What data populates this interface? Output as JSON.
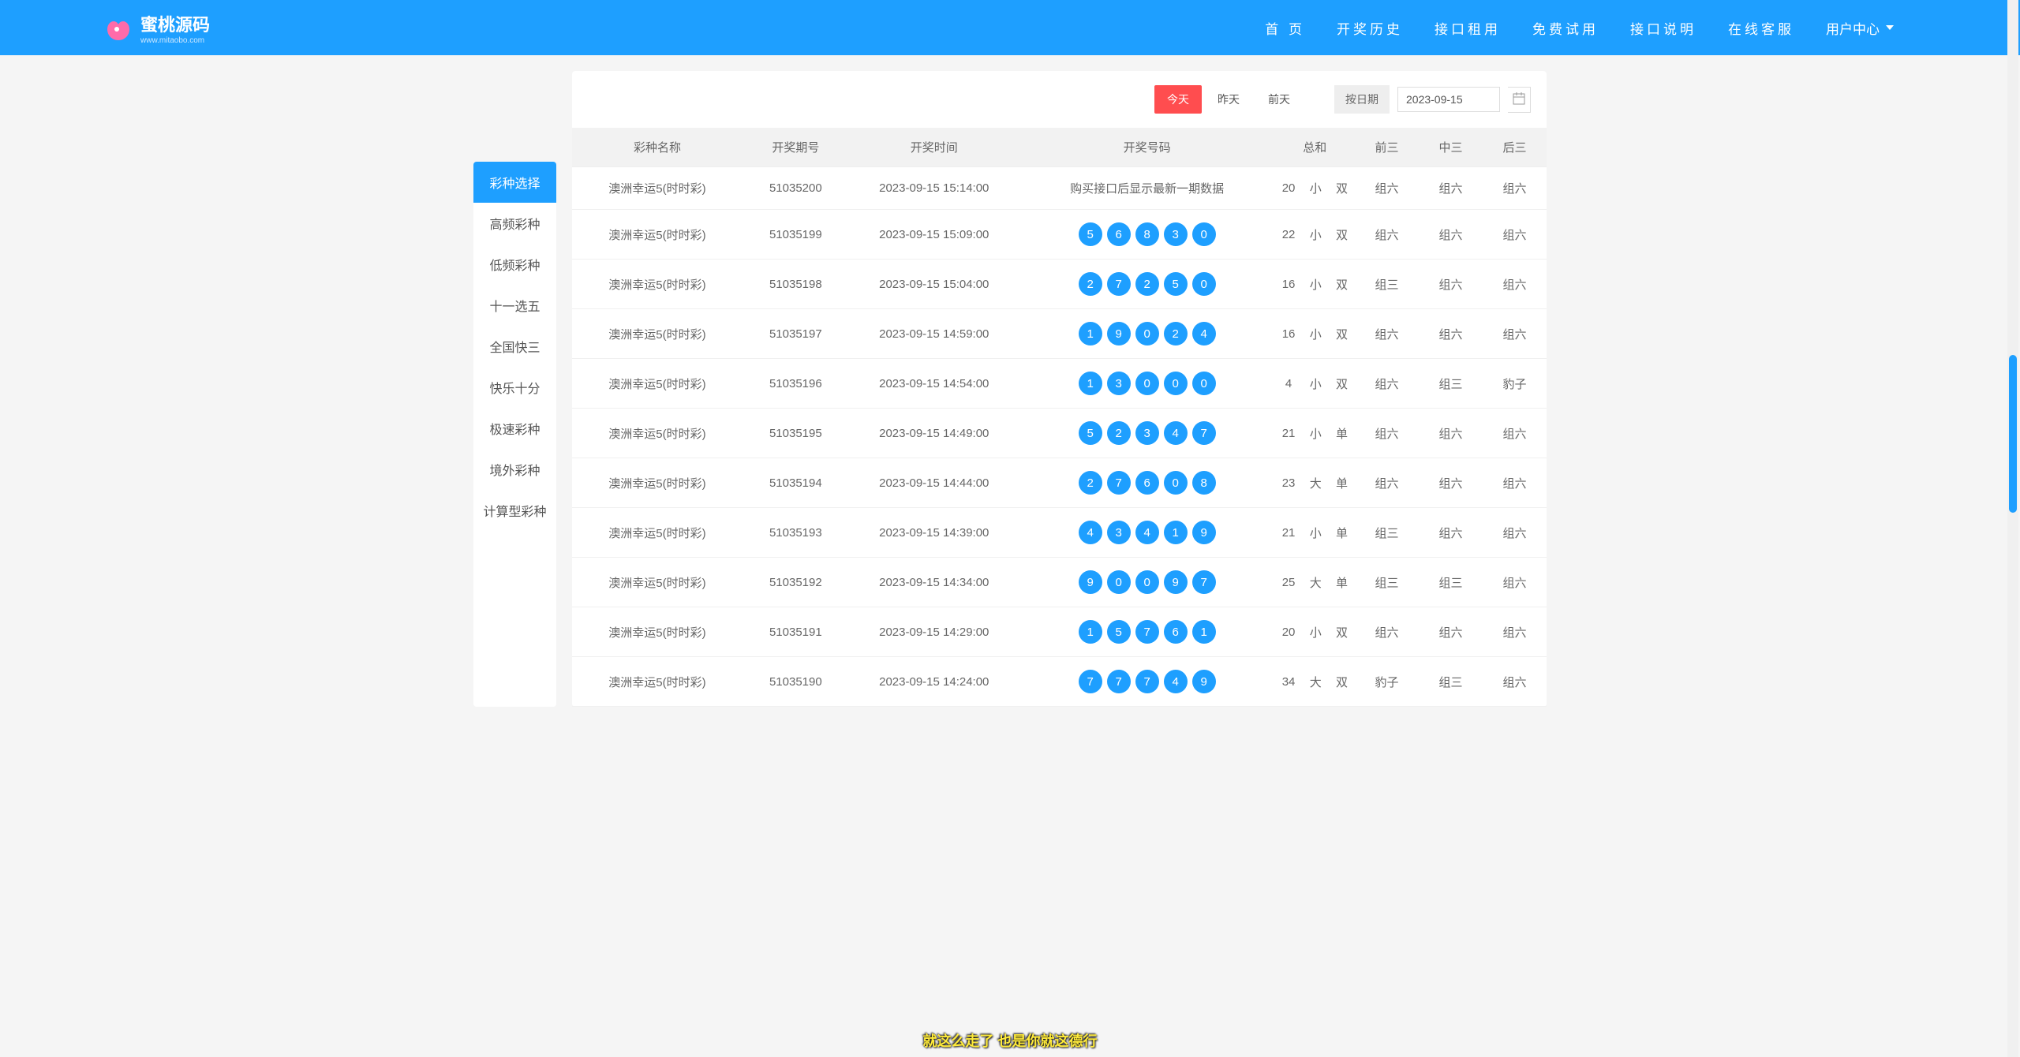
{
  "header": {
    "logo_title": "蜜桃源码",
    "logo_sub": "www.mitaobo.com",
    "nav": [
      "首 页",
      "开奖历史",
      "接口租用",
      "免费试用",
      "接口说明",
      "在线客服",
      "用户中心"
    ]
  },
  "sidebar": {
    "items": [
      "彩种选择",
      "高频彩种",
      "低频彩种",
      "十一选五",
      "全国快三",
      "快乐十分",
      "极速彩种",
      "境外彩种",
      "计算型彩种"
    ],
    "active_index": 0
  },
  "toolbar": {
    "days": [
      "今天",
      "昨天",
      "前天"
    ],
    "active_day": 0,
    "date_label": "按日期",
    "date_value": "2023-09-15"
  },
  "table": {
    "headers": [
      "彩种名称",
      "开奖期号",
      "开奖时间",
      "开奖号码",
      "总和",
      "",
      "",
      "前三",
      "中三",
      "后三"
    ],
    "rows": [
      {
        "name": "澳洲幸运5(时时彩)",
        "period": "51035200",
        "time": "2023-09-15 15:14:00",
        "balls_text": "购买接口后显示最新一期数据",
        "sum": "20",
        "size": "小",
        "oe": "双",
        "f3": "组六",
        "m3": "组六",
        "b3": "组六"
      },
      {
        "name": "澳洲幸运5(时时彩)",
        "period": "51035199",
        "time": "2023-09-15 15:09:00",
        "balls": [
          "5",
          "6",
          "8",
          "3",
          "0"
        ],
        "sum": "22",
        "size": "小",
        "oe": "双",
        "f3": "组六",
        "m3": "组六",
        "b3": "组六"
      },
      {
        "name": "澳洲幸运5(时时彩)",
        "period": "51035198",
        "time": "2023-09-15 15:04:00",
        "balls": [
          "2",
          "7",
          "2",
          "5",
          "0"
        ],
        "sum": "16",
        "size": "小",
        "oe": "双",
        "f3": "组三",
        "m3": "组六",
        "b3": "组六"
      },
      {
        "name": "澳洲幸运5(时时彩)",
        "period": "51035197",
        "time": "2023-09-15 14:59:00",
        "balls": [
          "1",
          "9",
          "0",
          "2",
          "4"
        ],
        "sum": "16",
        "size": "小",
        "oe": "双",
        "f3": "组六",
        "m3": "组六",
        "b3": "组六"
      },
      {
        "name": "澳洲幸运5(时时彩)",
        "period": "51035196",
        "time": "2023-09-15 14:54:00",
        "balls": [
          "1",
          "3",
          "0",
          "0",
          "0"
        ],
        "sum": "4",
        "size": "小",
        "oe": "双",
        "f3": "组六",
        "m3": "组三",
        "b3": "豹子"
      },
      {
        "name": "澳洲幸运5(时时彩)",
        "period": "51035195",
        "time": "2023-09-15 14:49:00",
        "balls": [
          "5",
          "2",
          "3",
          "4",
          "7"
        ],
        "sum": "21",
        "size": "小",
        "oe": "单",
        "f3": "组六",
        "m3": "组六",
        "b3": "组六"
      },
      {
        "name": "澳洲幸运5(时时彩)",
        "period": "51035194",
        "time": "2023-09-15 14:44:00",
        "balls": [
          "2",
          "7",
          "6",
          "0",
          "8"
        ],
        "sum": "23",
        "size": "大",
        "oe": "单",
        "f3": "组六",
        "m3": "组六",
        "b3": "组六"
      },
      {
        "name": "澳洲幸运5(时时彩)",
        "period": "51035193",
        "time": "2023-09-15 14:39:00",
        "balls": [
          "4",
          "3",
          "4",
          "1",
          "9"
        ],
        "sum": "21",
        "size": "小",
        "oe": "单",
        "f3": "组三",
        "m3": "组六",
        "b3": "组六"
      },
      {
        "name": "澳洲幸运5(时时彩)",
        "period": "51035192",
        "time": "2023-09-15 14:34:00",
        "balls": [
          "9",
          "0",
          "0",
          "9",
          "7"
        ],
        "sum": "25",
        "size": "大",
        "oe": "单",
        "f3": "组三",
        "m3": "组三",
        "b3": "组六"
      },
      {
        "name": "澳洲幸运5(时时彩)",
        "period": "51035191",
        "time": "2023-09-15 14:29:00",
        "balls": [
          "1",
          "5",
          "7",
          "6",
          "1"
        ],
        "sum": "20",
        "size": "小",
        "oe": "双",
        "f3": "组六",
        "m3": "组六",
        "b3": "组六"
      },
      {
        "name": "澳洲幸运5(时时彩)",
        "period": "51035190",
        "time": "2023-09-15 14:24:00",
        "balls": [
          "7",
          "7",
          "7",
          "4",
          "9"
        ],
        "sum": "34",
        "size": "大",
        "oe": "双",
        "f3": "豹子",
        "m3": "组三",
        "b3": "组六"
      }
    ]
  },
  "subtitle": "就这么走了 也是你就这德行",
  "color_map": {
    "小": "c-orange",
    "大": "c-green",
    "双": "c-orange",
    "单": "c-green",
    "组六": "c-green",
    "组三": "c-red",
    "豹子": "c-pink"
  }
}
